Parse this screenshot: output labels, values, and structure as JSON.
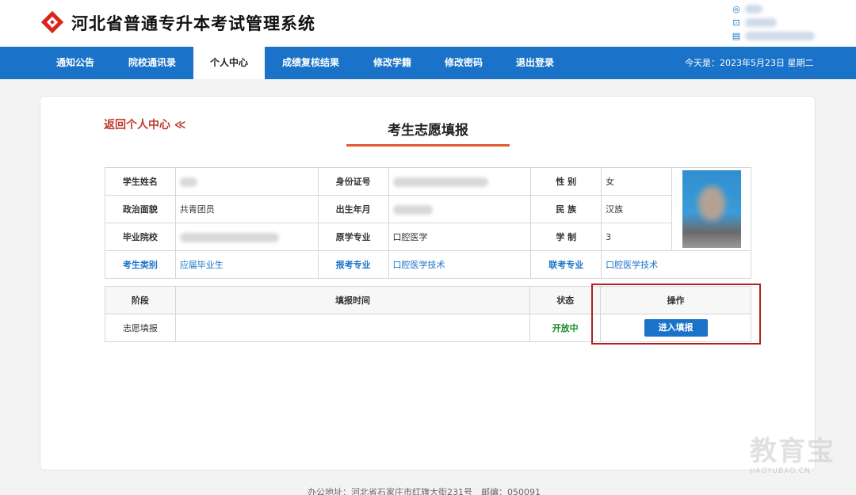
{
  "header": {
    "title": "河北省普通专升本考试管理系统",
    "logo_icon": "diamond-logo-icon",
    "user_icons": [
      "user-icon",
      "lock-icon",
      "id-icon"
    ]
  },
  "nav": {
    "items": [
      "通知公告",
      "院校通讯录",
      "个人中心",
      "成绩复核结果",
      "修改学籍",
      "修改密码",
      "退出登录"
    ],
    "active": "个人中心",
    "date": "今天是：2023年5月23日 星期二"
  },
  "page": {
    "back_link": "返回个人中心 ≪",
    "title": "考生志愿填报"
  },
  "info": {
    "name_label": "学生姓名",
    "id_label": "身份证号",
    "gender_label": "性 别",
    "gender": "女",
    "politics_label": "政治面貌",
    "politics": "共青团员",
    "birth_label": "出生年月",
    "ethnic_label": "民 族",
    "ethnic": "汉族",
    "school_label": "毕业院校",
    "major_label": "原学专业",
    "major": "口腔医学",
    "years_label": "学 制",
    "years": "3",
    "category_label": "考生类别",
    "category": "应届毕业生",
    "apply_major_label": "报考专业",
    "apply_major": "口腔医学技术",
    "joint_major_label": "联考专业",
    "joint_major": "口腔医学技术"
  },
  "stage_table": {
    "headers": [
      "阶段",
      "填报时间",
      "状态",
      "操作"
    ],
    "row": {
      "stage": "志愿填报",
      "time": "",
      "status": "开放中",
      "action": "进入填报"
    }
  },
  "colors": {
    "primary": "#1a73c8",
    "accent": "#e35a2e",
    "back_link": "#c0392b",
    "open_status": "#1a8a2a",
    "highlight": "#b0201e"
  },
  "footer": {
    "text": "办公地址：河北省石家庄市红旗大街231号　邮编：050091"
  },
  "watermark": {
    "big": "教育宝",
    "small": "JIAOYUBAO.CN"
  }
}
